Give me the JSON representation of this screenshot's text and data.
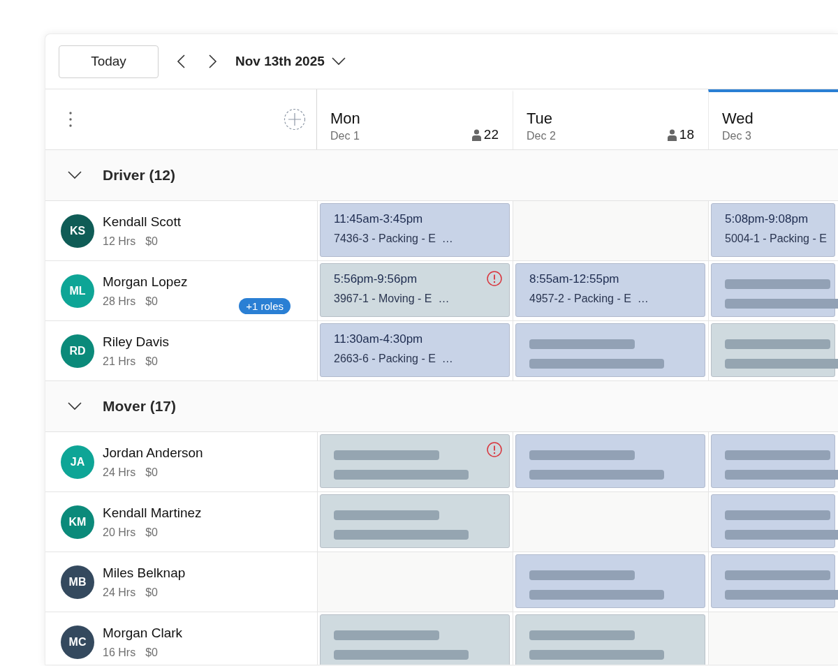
{
  "toolbar": {
    "today_button": "Today",
    "date": "Nov 13th 2025"
  },
  "days": [
    {
      "name": "Mon",
      "date": "Dec 1",
      "count": "22",
      "selected": false
    },
    {
      "name": "Tue",
      "date": "Dec 2",
      "count": "18",
      "selected": false
    },
    {
      "name": "Wed",
      "date": "Dec 3",
      "selected": true
    }
  ],
  "groups": [
    {
      "title": "Driver (12)",
      "expanded": true,
      "employees": [
        {
          "initials": "KS",
          "color": "#0f5c56",
          "name": "Kendall Scott",
          "hours": "12 Hrs",
          "cost": "$0",
          "shifts": [
            {
              "kind": "shift",
              "color": "#c8d3e7",
              "time": "11:45am-3:45pm",
              "detail": "7436-3 - Packing - E  …",
              "alert": false
            },
            {
              "kind": "empty"
            },
            {
              "kind": "shift",
              "color": "#c8d3e7",
              "time": "5:08pm-9:08pm",
              "detail": "5004-1 - Packing - E",
              "alert": false
            }
          ]
        },
        {
          "initials": "ML",
          "color": "#0ea596",
          "name": "Morgan Lopez",
          "hours": "28 Hrs",
          "cost": "$0",
          "badge": "+1 roles",
          "shifts": [
            {
              "kind": "shift",
              "color": "#cfdadf",
              "time": "5:56pm-9:56pm",
              "detail": "3967-1 - Moving - E  …",
              "alert": true
            },
            {
              "kind": "shift",
              "color": "#c8d3e7",
              "time": "8:55am-12:55pm",
              "detail": "4957-2 - Packing - E  …",
              "alert": false
            },
            {
              "kind": "placeholder",
              "color": "#c8d3e7",
              "alert": false
            }
          ]
        },
        {
          "initials": "RD",
          "color": "#0b8a7a",
          "name": "Riley Davis",
          "hours": "21 Hrs",
          "cost": "$0",
          "shifts": [
            {
              "kind": "shift",
              "color": "#c8d3e7",
              "time": "11:30am-4:30pm",
              "detail": "2663-6 - Packing - E  …",
              "alert": false
            },
            {
              "kind": "placeholder",
              "color": "#c8d3e7",
              "alert": false
            },
            {
              "kind": "placeholder",
              "color": "#cfdadf",
              "alert": false
            }
          ]
        }
      ]
    },
    {
      "title": "Mover (17)",
      "expanded": true,
      "employees": [
        {
          "initials": "JA",
          "color": "#0ea596",
          "name": "Jordan Anderson",
          "hours": "24 Hrs",
          "cost": "$0",
          "shifts": [
            {
              "kind": "placeholder",
              "color": "#cfdadf",
              "alert": true
            },
            {
              "kind": "placeholder",
              "color": "#c8d3e7",
              "alert": false
            },
            {
              "kind": "placeholder",
              "color": "#c8d3e7",
              "alert": false
            }
          ]
        },
        {
          "initials": "KM",
          "color": "#0b8a7a",
          "name": "Kendall Martinez",
          "hours": "20 Hrs",
          "cost": "$0",
          "shifts": [
            {
              "kind": "placeholder",
              "color": "#cfdadf",
              "alert": false
            },
            {
              "kind": "empty"
            },
            {
              "kind": "placeholder",
              "color": "#c8d3e7",
              "alert": false
            }
          ]
        },
        {
          "initials": "MB",
          "color": "#34495e",
          "name": "Miles Belknap",
          "hours": "24 Hrs",
          "cost": "$0",
          "shifts": [
            {
              "kind": "empty"
            },
            {
              "kind": "placeholder",
              "color": "#c8d3e7",
              "alert": false
            },
            {
              "kind": "placeholder",
              "color": "#c8d3e7",
              "alert": false
            }
          ]
        },
        {
          "initials": "MC",
          "color": "#34495e",
          "name": "Morgan Clark",
          "hours": "16 Hrs",
          "cost": "$0",
          "shifts": [
            {
              "kind": "placeholder",
              "color": "#cfdadf",
              "alert": false
            },
            {
              "kind": "placeholder",
              "color": "#cfdadf",
              "alert": false
            },
            {
              "kind": "empty"
            }
          ]
        }
      ]
    }
  ]
}
